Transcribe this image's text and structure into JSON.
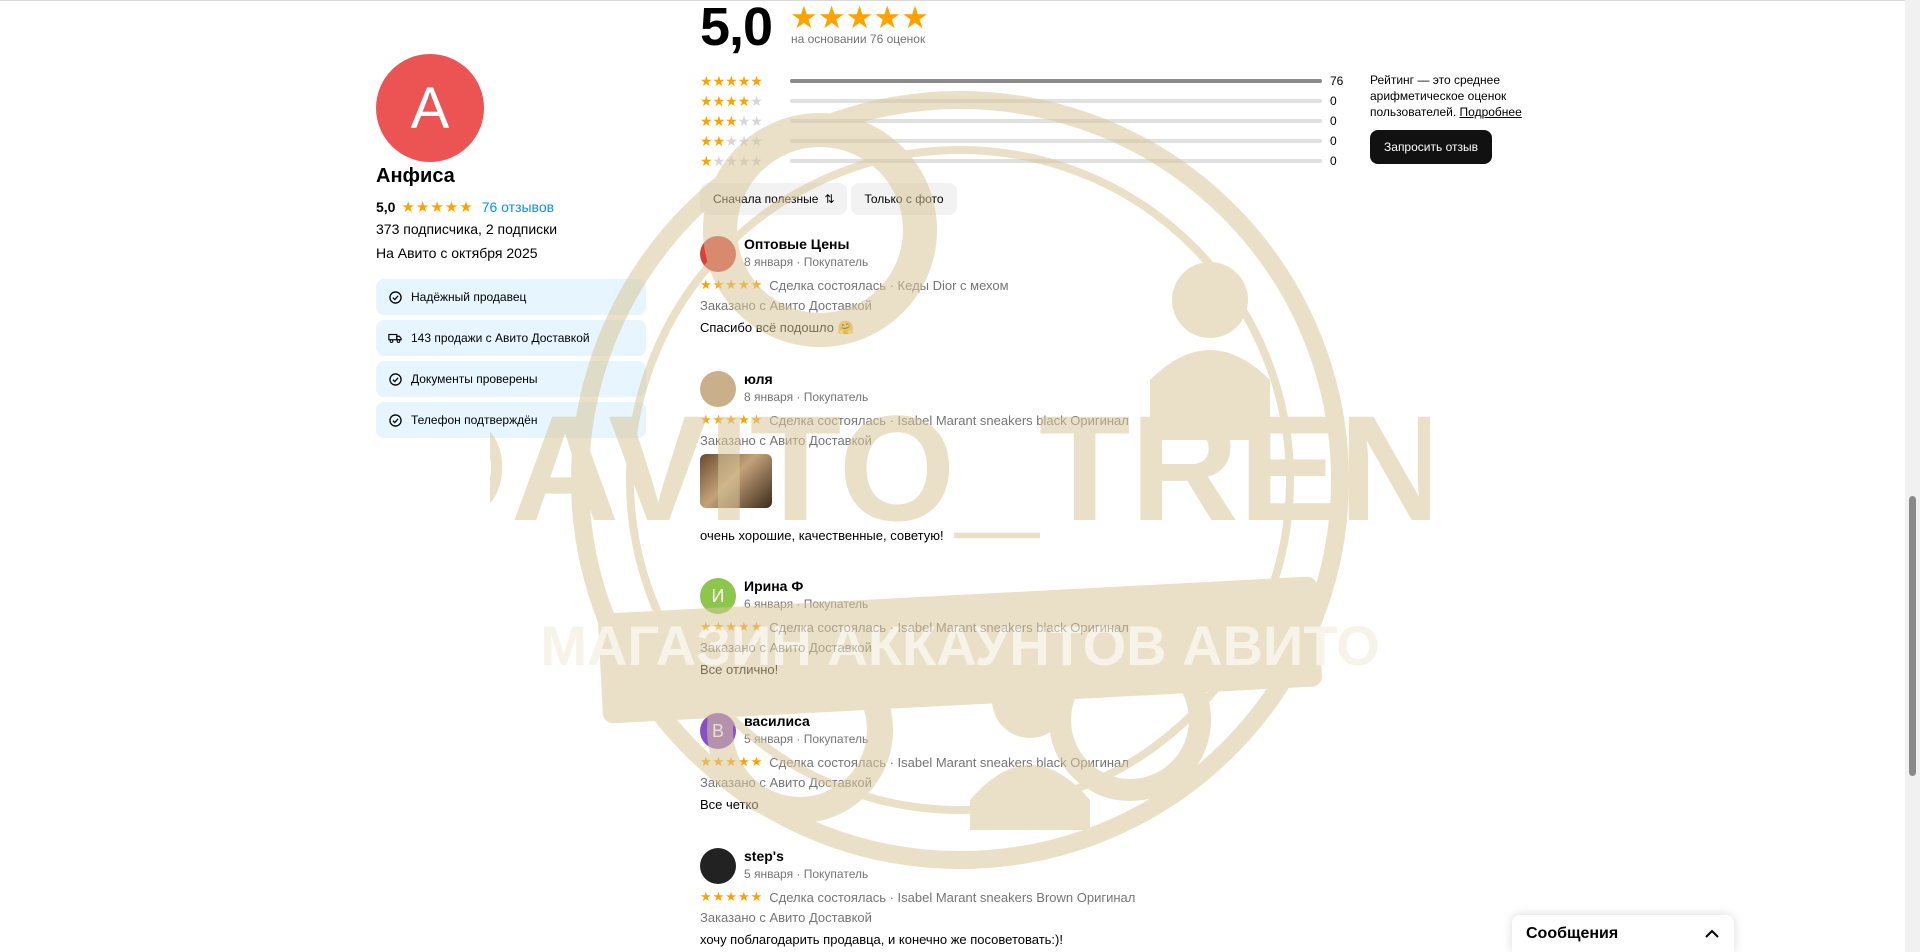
{
  "profile": {
    "avatar_letter": "А",
    "name": "Анфиса",
    "score": "5,0",
    "stars": "★★★★★",
    "reviews_link": "76 отзывов",
    "subscribers": "373 подписчика, 2 подписки",
    "since": "На Авито с октября 2025",
    "badges": [
      {
        "icon": "check-circle-icon",
        "label": "Надёжный продавец"
      },
      {
        "icon": "truck-icon",
        "label": "143 продажи с Авито Доставкой"
      },
      {
        "icon": "check-circle-icon",
        "label": "Документы проверены"
      },
      {
        "icon": "check-circle-icon",
        "label": "Телефон подтверждён"
      }
    ]
  },
  "summary": {
    "score": "5,0",
    "stars": "★★★★★",
    "based_on": "на основании 76 оценок",
    "distribution": [
      {
        "stars": 5,
        "count": "76",
        "fraction": 1.0
      },
      {
        "stars": 4,
        "count": "0",
        "fraction": 0
      },
      {
        "stars": 3,
        "count": "0",
        "fraction": 0
      },
      {
        "stars": 2,
        "count": "0",
        "fraction": 0
      },
      {
        "stars": 1,
        "count": "0",
        "fraction": 0
      }
    ],
    "note_text": "Рейтинг — это среднее арифметическое оценок пользователей.",
    "note_link": "Подробнее",
    "request_button": "Запросить отзыв"
  },
  "filters": {
    "sort_label": "Сначала полезные",
    "photo_label": "Только с фото"
  },
  "reviews": [
    {
      "name": "Оптовые Цены",
      "meta": "8 января · Покупатель",
      "deal": "Сделка состоялась · Кеды Dior с мехом",
      "order": "Заказано с Авито Доставкой",
      "text": "Спасибо всё подошло 🤗",
      "avatar_letter": "",
      "avatar_color": "#d9403a"
    },
    {
      "name": "юля",
      "meta": "8 января · Покупатель",
      "deal": "Сделка состоялась · Isabel Marant sneakers black Оригинал",
      "order": "Заказано с Авито Доставкой",
      "text": "очень хорошие, качественные, советую!",
      "avatar_letter": "",
      "avatar_color": "#c9b08a",
      "has_photo": true
    },
    {
      "name": "Ирина Ф",
      "meta": "6 января · Покупатель",
      "deal": "Сделка состоялась · Isabel Marant sneakers black Оригинал",
      "order": "Заказано с Авито Доставкой",
      "text": "Все отлично!",
      "avatar_letter": "И",
      "avatar_color": "#8cc64a"
    },
    {
      "name": "василиса",
      "meta": "5 января · Покупатель",
      "deal": "Сделка состоялась · Isabel Marant sneakers black Оригинал",
      "order": "Заказано с Авито Доставкой",
      "text": "Все четко",
      "avatar_letter": "В",
      "avatar_color": "#8a4fc6"
    },
    {
      "name": "step's",
      "meta": "5 января · Покупатель",
      "deal": "Сделка состоялась · Isabel Marant sneakers Brown Оригинал",
      "order": "Заказано с Авито Доставкой",
      "text": "хочу поблагодарить продавца, и конечно же посоветовать:)!",
      "avatar_letter": "",
      "avatar_color": "#222222"
    }
  ],
  "review_stars": "★★★★★",
  "messages_widget": {
    "title": "Сообщения"
  },
  "watermark": {
    "text": "@AVITO_TREND",
    "banner": "МАГАЗИН АККАУНТОВ АВИТО",
    "color": "#d8c79a"
  }
}
